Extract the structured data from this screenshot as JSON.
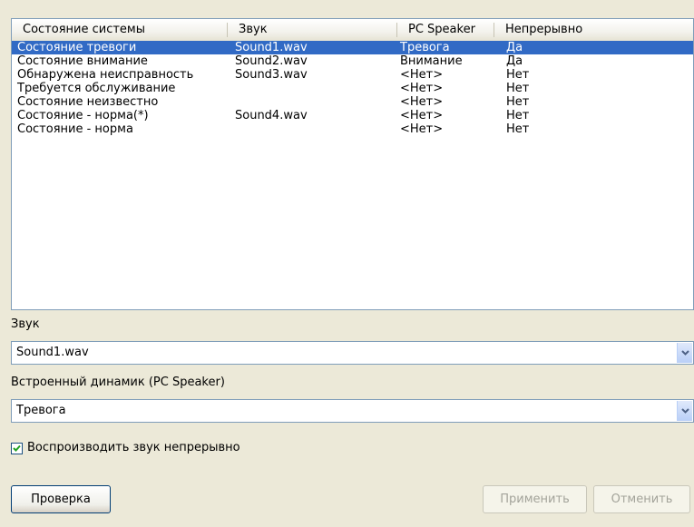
{
  "table": {
    "columns": [
      "Состояние системы",
      "Звук",
      "PC Speaker",
      "Непрерывно"
    ],
    "rows": [
      {
        "state": "Состояние тревоги",
        "sound": "Sound1.wav",
        "speaker": "Тревога",
        "continuous": "Да"
      },
      {
        "state": "Состояние внимание",
        "sound": "Sound2.wav",
        "speaker": "Внимание",
        "continuous": "Да"
      },
      {
        "state": "Обнаружена неисправность",
        "sound": "Sound3.wav",
        "speaker": "<Нет>",
        "continuous": "Нет"
      },
      {
        "state": "Требуется обслуживание",
        "sound": "",
        "speaker": "<Нет>",
        "continuous": "Нет"
      },
      {
        "state": "Состояние неизвестно",
        "sound": "",
        "speaker": "<Нет>",
        "continuous": "Нет"
      },
      {
        "state": "Состояние - норма(*)",
        "sound": "Sound4.wav",
        "speaker": "<Нет>",
        "continuous": "Нет"
      },
      {
        "state": "Состояние - норма",
        "sound": "",
        "speaker": "<Нет>",
        "continuous": "Нет"
      }
    ],
    "selected_row": 0
  },
  "sound": {
    "label": "Звук",
    "value": "Sound1.wav"
  },
  "speaker": {
    "label": "Встроенный динамик (PC Speaker)",
    "value": "Тревога"
  },
  "continuous": {
    "label": "Воспроизводить звук непрерывно",
    "checked": true
  },
  "buttons": {
    "test": "Проверка",
    "apply": "Применить",
    "cancel": "Отменить"
  },
  "colors": {
    "selection": "#316ac5",
    "window": "#ece9d8",
    "border": "#7f9db9"
  },
  "icons": {
    "combo_arrow": "chevron-down-icon",
    "check": "checkmark-icon"
  }
}
